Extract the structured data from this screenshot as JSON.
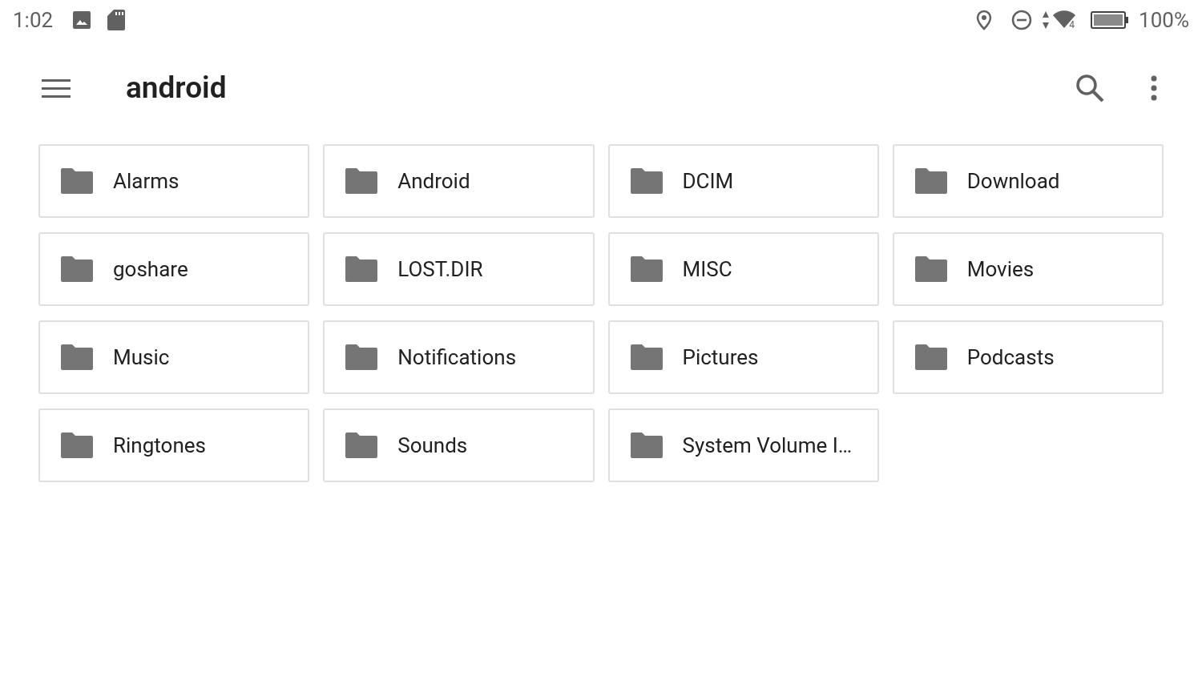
{
  "status_bar": {
    "time": "1:02",
    "battery_text": "100%",
    "network_label": "4"
  },
  "toolbar": {
    "title": "android"
  },
  "folders": [
    {
      "name": "Alarms"
    },
    {
      "name": "Android"
    },
    {
      "name": "DCIM"
    },
    {
      "name": "Download"
    },
    {
      "name": "goshare"
    },
    {
      "name": "LOST.DIR"
    },
    {
      "name": "MISC"
    },
    {
      "name": "Movies"
    },
    {
      "name": "Music"
    },
    {
      "name": "Notifications"
    },
    {
      "name": "Pictures"
    },
    {
      "name": "Podcasts"
    },
    {
      "name": "Ringtones"
    },
    {
      "name": "Sounds"
    },
    {
      "name": "System Volume I…"
    }
  ]
}
